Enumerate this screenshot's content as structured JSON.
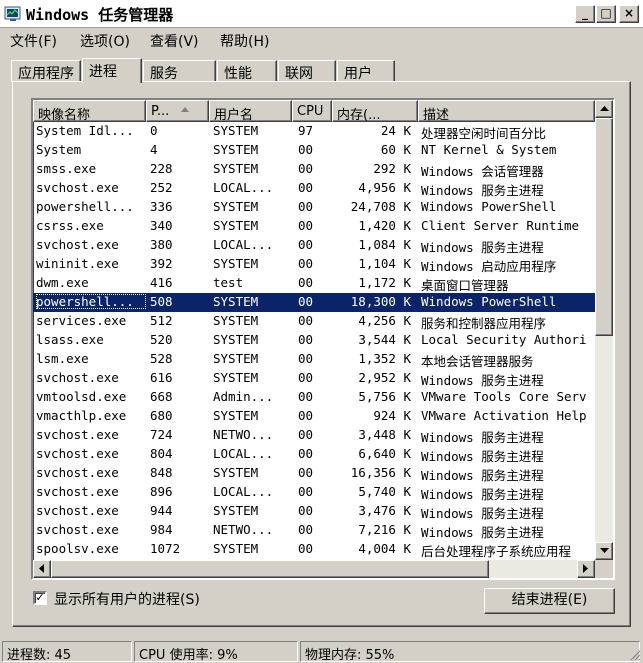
{
  "window": {
    "title": "Windows 任务管理器",
    "minimize_glyph": "_",
    "maximize_glyph": "□",
    "close_glyph": "×"
  },
  "menu": [
    "文件(F)",
    "选项(O)",
    "查看(V)",
    "帮助(H)"
  ],
  "tabs": [
    {
      "label": "应用程序",
      "active": false
    },
    {
      "label": "进程",
      "active": true
    },
    {
      "label": "服务",
      "active": false
    },
    {
      "label": "性能",
      "active": false
    },
    {
      "label": "联网",
      "active": false
    },
    {
      "label": "用户",
      "active": false
    }
  ],
  "table": {
    "columns": [
      "映像名称",
      "P...",
      "用户名",
      "CPU",
      "内存(...",
      "描述"
    ],
    "sort_column": 1,
    "rows": [
      [
        "System Idl...",
        "0",
        "SYSTEM",
        "97",
        "24 K",
        "处理器空闲时间百分比"
      ],
      [
        "System",
        "4",
        "SYSTEM",
        "00",
        "60 K",
        "NT Kernel & System"
      ],
      [
        "smss.exe",
        "228",
        "SYSTEM",
        "00",
        "292 K",
        "Windows 会话管理器"
      ],
      [
        "svchost.exe",
        "252",
        "LOCAL...",
        "00",
        "4,956 K",
        "Windows 服务主进程"
      ],
      [
        "powershell...",
        "336",
        "SYSTEM",
        "00",
        "24,708 K",
        "Windows PowerShell"
      ],
      [
        "csrss.exe",
        "340",
        "SYSTEM",
        "00",
        "1,420 K",
        "Client Server Runtime"
      ],
      [
        "svchost.exe",
        "380",
        "LOCAL...",
        "00",
        "1,084 K",
        "Windows 服务主进程"
      ],
      [
        "wininit.exe",
        "392",
        "SYSTEM",
        "00",
        "1,104 K",
        "Windows 启动应用程序"
      ],
      [
        "dwm.exe",
        "416",
        "test",
        "00",
        "1,172 K",
        "桌面窗口管理器"
      ],
      [
        "powershell...",
        "508",
        "SYSTEM",
        "00",
        "18,300 K",
        "Windows PowerShell"
      ],
      [
        "services.exe",
        "512",
        "SYSTEM",
        "00",
        "4,256 K",
        "服务和控制器应用程序"
      ],
      [
        "lsass.exe",
        "520",
        "SYSTEM",
        "00",
        "3,544 K",
        "Local Security Authori"
      ],
      [
        "lsm.exe",
        "528",
        "SYSTEM",
        "00",
        "1,352 K",
        "本地会话管理器服务"
      ],
      [
        "svchost.exe",
        "616",
        "SYSTEM",
        "00",
        "2,952 K",
        "Windows 服务主进程"
      ],
      [
        "vmtoolsd.exe",
        "668",
        "Admin...",
        "00",
        "5,756 K",
        "VMware Tools Core Serv"
      ],
      [
        "vmacthlp.exe",
        "680",
        "SYSTEM",
        "00",
        "924 K",
        "VMware Activation Help"
      ],
      [
        "svchost.exe",
        "724",
        "NETWO...",
        "00",
        "3,448 K",
        "Windows 服务主进程"
      ],
      [
        "svchost.exe",
        "804",
        "LOCAL...",
        "00",
        "6,640 K",
        "Windows 服务主进程"
      ],
      [
        "svchost.exe",
        "848",
        "SYSTEM",
        "00",
        "16,356 K",
        "Windows 服务主进程"
      ],
      [
        "svchost.exe",
        "896",
        "LOCAL...",
        "00",
        "5,740 K",
        "Windows 服务主进程"
      ],
      [
        "svchost.exe",
        "944",
        "SYSTEM",
        "00",
        "3,476 K",
        "Windows 服务主进程"
      ],
      [
        "svchost.exe",
        "984",
        "NETWO...",
        "00",
        "7,216 K",
        "Windows 服务主进程"
      ],
      [
        "spoolsv.exe",
        "1072",
        "SYSTEM",
        "00",
        "4,004 K",
        "后台处理程序子系统应用程"
      ]
    ],
    "selected_row": 9
  },
  "show_all_users": {
    "label": "显示所有用户的进程(S)",
    "checked": true,
    "check_glyph": "✓"
  },
  "end_process_button": "结束进程(E)",
  "status": {
    "processes": "进程数: 45",
    "cpu": "CPU 使用率: 9%",
    "memory": "物理内存: 55%"
  },
  "colors": {
    "selection": "#0a246a",
    "face": "#d4d0c8"
  }
}
